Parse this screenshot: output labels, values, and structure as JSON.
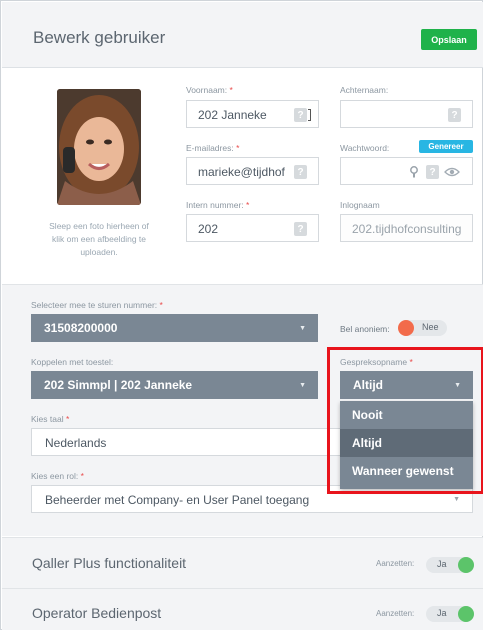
{
  "header": {
    "title": "Bewerk gebruiker",
    "save_label": "Opslaan"
  },
  "photo": {
    "hint": "Sleep een foto hierheen of klik om een afbeelding te uploaden."
  },
  "form": {
    "voornaam_label": "Voornaam:",
    "voornaam_value": "202 Janneke",
    "achternaam_label": "Achternaam:",
    "achternaam_value": "",
    "email_label": "E-mailadres:",
    "email_value": "marieke@tijdhof",
    "password_label": "Wachtwoord:",
    "generate_label": "Genereer",
    "intern_label": "Intern nummer:",
    "intern_value": "202",
    "login_label": "Inlognaam",
    "login_value": "202.tijdhofconsulting",
    "required_mark": "*",
    "help_mark": "?"
  },
  "section2": {
    "number_label": "Selecteer mee te sturen nummer:",
    "number_value": "31508200000",
    "anon_label": "Bel anoniem:",
    "anon_state": "Nee",
    "device_label": "Koppelen met toestel:",
    "device_value": "202 Simmpl | 202 Janneke",
    "recording_label": "Gespreksopname",
    "recording_value": "Altijd",
    "recording_options": [
      "Nooit",
      "Altijd",
      "Wanneer gewenst"
    ],
    "recording_selected_index": 1,
    "language_label": "Kies taal",
    "language_value": "Nederlands",
    "role_label": "Kies een rol:",
    "role_value": "Beheerder met Company- en User Panel toegang"
  },
  "panels": [
    {
      "title": "Qaller Plus functionaliteit",
      "toggle_label": "Aanzetten:",
      "state": "Ja"
    },
    {
      "title": "Operator Bedienpost",
      "toggle_label": "Aanzetten:",
      "state": "Ja"
    }
  ],
  "colors": {
    "save": "#1fb24a",
    "generate": "#28b6e3",
    "toggle_off": "#f26b4b",
    "toggle_on": "#5cc46a",
    "highlight": "#e8141c",
    "select": "#7a8794"
  },
  "icons": {
    "caret": "caret-down-icon",
    "help": "question-mark-icon",
    "eye": "eye-icon",
    "key": "key-icon"
  }
}
